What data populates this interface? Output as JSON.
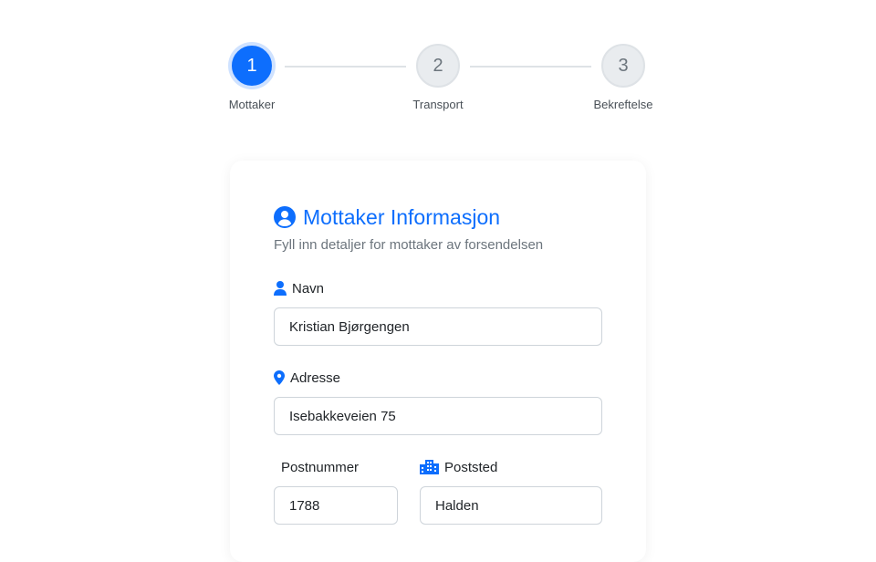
{
  "stepper": {
    "steps": [
      {
        "number": "1",
        "label": "Mottaker",
        "state": "active"
      },
      {
        "number": "2",
        "label": "Transport",
        "state": "inactive"
      },
      {
        "number": "3",
        "label": "Bekreftelse",
        "state": "inactive"
      }
    ]
  },
  "form": {
    "title": "Mottaker Informasjon",
    "subtitle": "Fyll inn detaljer for mottaker av forsendelsen",
    "fields": {
      "navn": {
        "label": "Navn",
        "value": "Kristian Bjørgengen",
        "icon": "person-icon"
      },
      "adresse": {
        "label": "Adresse",
        "value": "Isebakkeveien 75",
        "icon": "map-pin-icon"
      },
      "postnummer": {
        "label": "Postnummer",
        "value": "1788"
      },
      "poststed": {
        "label": "Poststed",
        "value": "Halden",
        "icon": "city-icon"
      }
    }
  },
  "colors": {
    "accent": "#0d6efd",
    "inactive_step": "#e9ecef",
    "border": "#ced4da"
  }
}
